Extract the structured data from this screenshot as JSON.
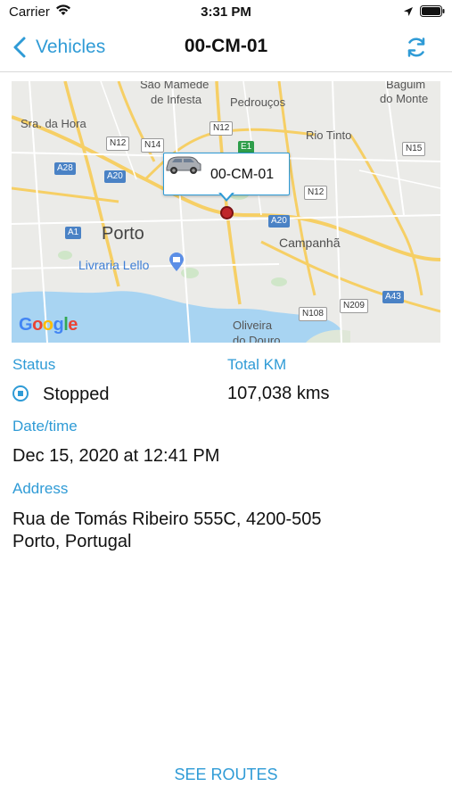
{
  "status_bar": {
    "carrier": "Carrier",
    "time": "3:31 PM",
    "icons": [
      "wifi-icon",
      "location-arrow-icon",
      "battery-icon"
    ]
  },
  "nav": {
    "back_label": "Vehicles",
    "title": "00-CM-01",
    "refresh_icon": "refresh-icon"
  },
  "map": {
    "callout_label": "00-CM-01",
    "labels": {
      "sao_mamede": "São Mamede",
      "de_infesta": "de Infesta",
      "pedroucos": "Pedrouços",
      "baguim": "Baguim",
      "do_monte": "do Monte",
      "sra_da_hora": "Sra. da Hora",
      "rio_tinto": "Rio Tinto",
      "porto": "Porto",
      "campanha": "Campanhã",
      "livraria_lello": "Livraria Lello",
      "oliveira": "Oliveira",
      "do_douro": "do Douro"
    },
    "roads": {
      "n12_a": "N12",
      "n14": "N14",
      "n12_b": "N12",
      "e1": "E1",
      "n15": "N15",
      "a28": "A28",
      "a20_a": "A20",
      "n12_c": "N12",
      "a20_b": "A20",
      "a1": "A1",
      "a43": "A43",
      "n108": "N108",
      "n209": "N209"
    },
    "attribution": "Google"
  },
  "details": {
    "status_label": "Status",
    "status_value": "Stopped",
    "total_km_label": "Total KM",
    "total_km_value": "107,038 kms",
    "datetime_label": "Date/time",
    "datetime_value": "Dec 15, 2020 at 12:41 PM",
    "address_label": "Address",
    "address_line1": "Rua de Tomás Ribeiro 555C, 4200-505",
    "address_line2": "Porto, Portugal"
  },
  "footer": {
    "see_routes_label": "SEE ROUTES"
  },
  "colors": {
    "accent": "#2f9bd6",
    "marker": "#c0262b",
    "river": "#a8d4f2"
  }
}
